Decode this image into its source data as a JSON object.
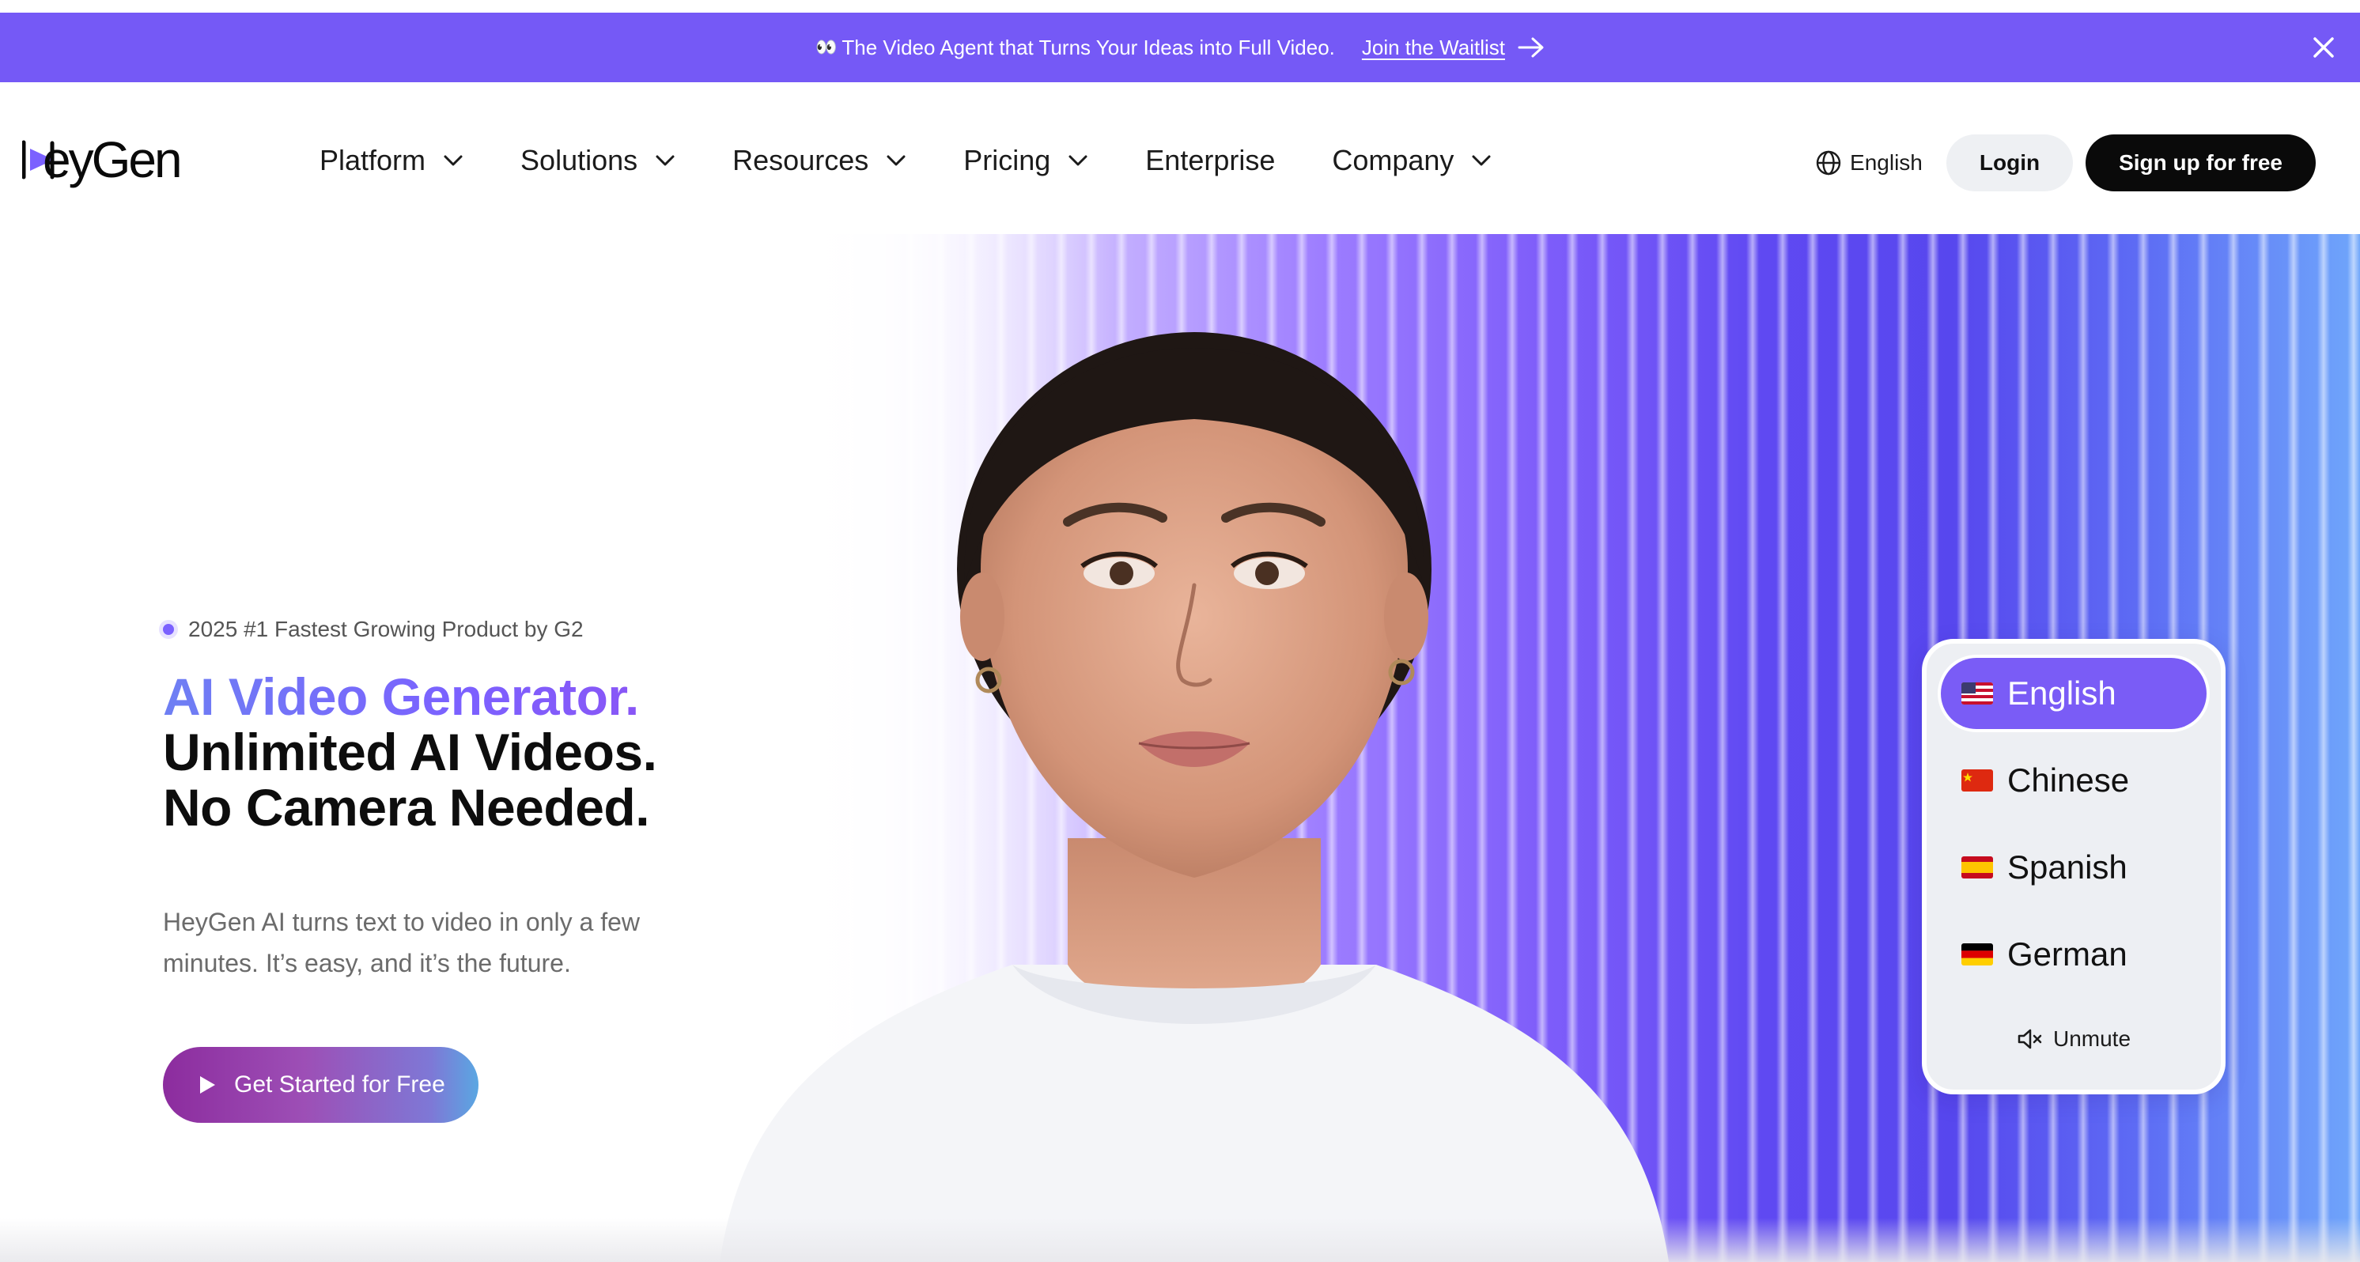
{
  "banner": {
    "eyes_icon": "👀",
    "text": "The Video Agent that Turns Your Ideas into Full Video.",
    "link_label": "Join the Waitlist",
    "color": "#7559f6"
  },
  "brand": {
    "name": "HeyGen"
  },
  "nav": {
    "items": [
      {
        "label": "Platform",
        "has_dropdown": true
      },
      {
        "label": "Solutions",
        "has_dropdown": true
      },
      {
        "label": "Resources",
        "has_dropdown": true
      },
      {
        "label": "Pricing",
        "has_dropdown": true
      },
      {
        "label": "Enterprise",
        "has_dropdown": false
      },
      {
        "label": "Company",
        "has_dropdown": true
      }
    ],
    "language": "English",
    "login_label": "Login",
    "signup_label": "Sign up for free"
  },
  "hero": {
    "badge": "2025 #1 Fastest Growing Product by G2",
    "title_gradient": "AI Video Generator.",
    "title_line2": "Unlimited AI Videos.",
    "title_line3": "No Camera Needed.",
    "subtitle": "HeyGen AI turns text to video in only a few minutes. It’s easy, and it’s the future.",
    "cta_label": "Get Started for Free",
    "accent_color": "#7b61ff"
  },
  "language_picker": {
    "options": [
      {
        "label": "English",
        "flag": "us",
        "active": true
      },
      {
        "label": "Chinese",
        "flag": "cn",
        "active": false
      },
      {
        "label": "Spanish",
        "flag": "es",
        "active": false
      },
      {
        "label": "German",
        "flag": "de",
        "active": false
      }
    ],
    "unmute_label": "Unmute"
  }
}
